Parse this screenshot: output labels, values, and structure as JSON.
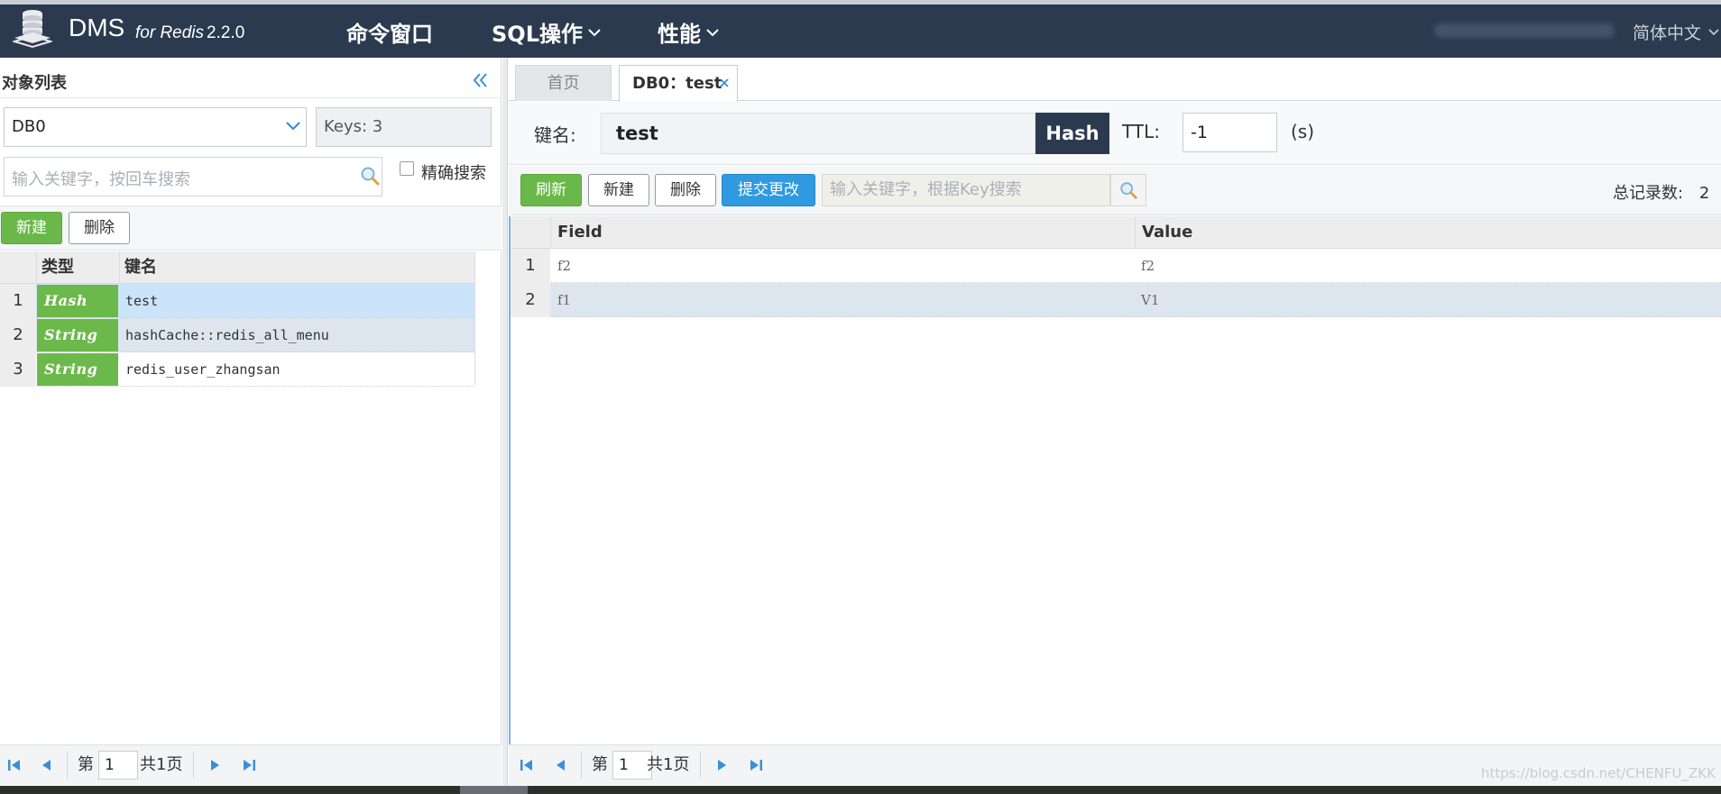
{
  "app": {
    "name": "DMS",
    "subtitle": "for Redis",
    "version": "2.2.0",
    "language": "简体中文"
  },
  "nav": {
    "command_window": "命令窗口",
    "sql_ops": "SQL操作",
    "performance": "性能"
  },
  "left": {
    "panel_title": "对象列表",
    "db_selected": "DB0",
    "keys_count": "Keys: 3",
    "search_placeholder": "输入关键字，按回车搜索",
    "exact_search_label": "精确搜索",
    "new_label": "新建",
    "delete_label": "删除",
    "columns": {
      "type": "类型",
      "key": "键名"
    },
    "rows": [
      {
        "num": "1",
        "type": "Hash",
        "key": "test"
      },
      {
        "num": "2",
        "type": "String",
        "key": "hashCache::redis_all_menu"
      },
      {
        "num": "3",
        "type": "String",
        "key": "redis_user_zhangsan"
      }
    ],
    "pager": {
      "page_prefix": "第",
      "page": "1",
      "page_total": "共1页"
    }
  },
  "tabs": {
    "home": "首页",
    "active": "DB0：test"
  },
  "detail": {
    "key_label": "键名:",
    "key_name": "test",
    "type": "Hash",
    "ttl_label": "TTL:",
    "ttl_value": "-1",
    "ttl_unit": "(s)",
    "refresh_label": "刷新",
    "new_label": "新建",
    "delete_label": "删除",
    "submit_label": "提交更改",
    "search_placeholder": "输入关键字，根据Key搜索",
    "total_label": "总记录数:",
    "total": "2",
    "columns": {
      "field": "Field",
      "value": "Value"
    },
    "rows": [
      {
        "num": "1",
        "field": "f2",
        "value": "f2"
      },
      {
        "num": "2",
        "field": "f1",
        "value": "V1"
      }
    ],
    "pager": {
      "page_prefix": "第",
      "page": "1",
      "page_total": "共1页"
    }
  },
  "watermark": "https://blog.csdn.net/CHENFU_ZKK",
  "colors": {
    "header_bg": "#2c3a50",
    "green": "#6ab84a",
    "blue": "#2f9ae0",
    "selected_row": "#cce4fa",
    "alt_row": "#dde6ee"
  }
}
